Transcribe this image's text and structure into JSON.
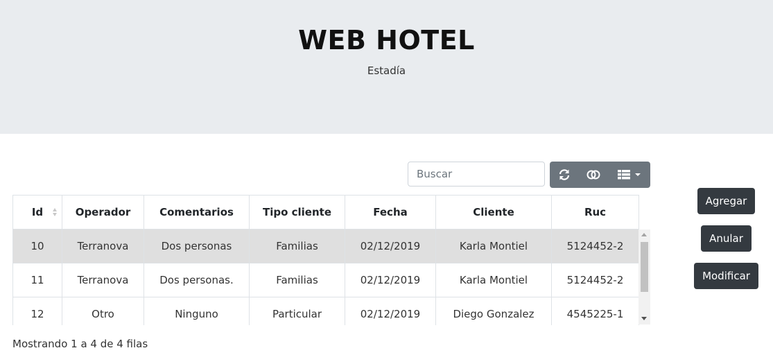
{
  "header": {
    "title": "WEB HOTEL",
    "subtitle": "Estadía"
  },
  "search": {
    "placeholder": "Buscar",
    "value": ""
  },
  "toolbar": {
    "icons": [
      "refresh-icon",
      "toggle-icon",
      "columns-icon",
      "caret-down-icon"
    ]
  },
  "table": {
    "columns": [
      "Id",
      "Operador",
      "Comentarios",
      "Tipo cliente",
      "Fecha",
      "Cliente",
      "Ruc"
    ],
    "rows": [
      [
        "10",
        "Terranova",
        "Dos personas",
        "Familias",
        "02/12/2019",
        "Karla Montiel",
        "5124452-2"
      ],
      [
        "11",
        "Terranova",
        "Dos personas.",
        "Familias",
        "02/12/2019",
        "Karla Montiel",
        "5124452-2"
      ],
      [
        "12",
        "Otro",
        "Ninguno",
        "Particular",
        "02/12/2019",
        "Diego Gonzalez",
        "4545225-1"
      ]
    ],
    "selected_row_index": 0
  },
  "pagination": {
    "info": "Mostrando 1 a 4 de 4 filas"
  },
  "actions": {
    "add": "Agregar",
    "cancel": "Anular",
    "edit": "Modificar"
  },
  "colors": {
    "jumbotron": "#e9ecef",
    "toolbar": "#6c757d",
    "action_button": "#343a40",
    "selected_row": "#dfdfdf"
  }
}
